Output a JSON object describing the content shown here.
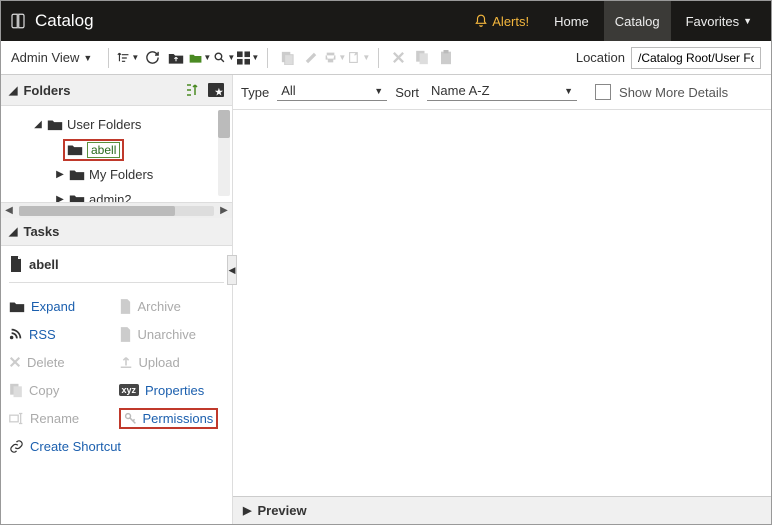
{
  "topbar": {
    "title": "Catalog",
    "alerts": "Alerts!",
    "nav": {
      "home": "Home",
      "catalog": "Catalog",
      "favorites": "Favorites"
    }
  },
  "toolbar": {
    "admin_view": "Admin View",
    "location_label": "Location",
    "location_value": "/Catalog Root/User Folders"
  },
  "folders": {
    "header": "Folders",
    "items": {
      "user_folders": "User Folders",
      "abell": "abell",
      "my_folders": "My Folders",
      "admin2": "admin2"
    }
  },
  "tasks": {
    "header": "Tasks",
    "target": "abell",
    "expand": "Expand",
    "rss": "RSS",
    "delete": "Delete",
    "copy": "Copy",
    "rename": "Rename",
    "create_shortcut": "Create Shortcut",
    "archive": "Archive",
    "unarchive": "Unarchive",
    "upload": "Upload",
    "properties": "Properties",
    "permissions": "Permissions"
  },
  "filter": {
    "type_label": "Type",
    "type_value": "All",
    "sort_label": "Sort",
    "sort_value": "Name A-Z",
    "show_more": "Show More Details"
  },
  "preview": {
    "label": "Preview"
  }
}
